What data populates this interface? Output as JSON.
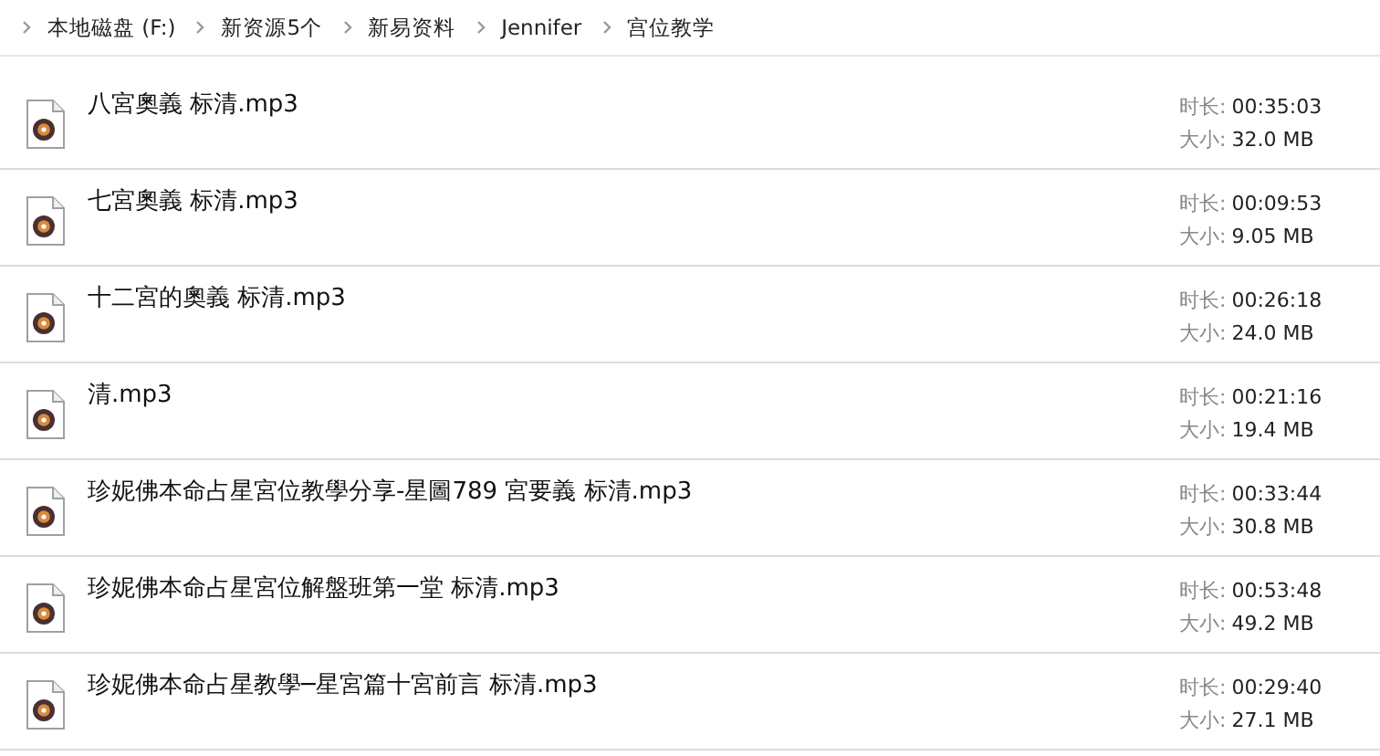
{
  "breadcrumb": [
    "本地磁盘 (F:)",
    "新资源5个",
    "新易资料",
    "Jennifer",
    "宫位教学"
  ],
  "files": [
    {
      "name": "八宮奧義 标清.mp3",
      "duration_label": "时长:",
      "duration": "00:35:03",
      "size_label": "大小:",
      "size": "32.0 MB"
    },
    {
      "name": "七宮奧義 标清.mp3",
      "duration_label": "时长:",
      "duration": "00:09:53",
      "size_label": "大小:",
      "size": "9.05 MB"
    },
    {
      "name": "十二宮的奧義 标清.mp3",
      "duration_label": "时长:",
      "duration": "00:26:18",
      "size_label": "大小:",
      "size": "24.0 MB"
    },
    {
      "name": "清.mp3",
      "duration_label": "时长:",
      "duration": "00:21:16",
      "size_label": "大小:",
      "size": "19.4 MB"
    },
    {
      "name": "珍妮佛本命占星宮位教學分享-星圖789 宮要義 标清.mp3",
      "duration_label": "时长:",
      "duration": "00:33:44",
      "size_label": "大小:",
      "size": "30.8 MB"
    },
    {
      "name": "珍妮佛本命占星宮位解盤班第一堂 标清.mp3",
      "duration_label": "时长:",
      "duration": "00:53:48",
      "size_label": "大小:",
      "size": "49.2 MB"
    },
    {
      "name": "珍妮佛本命占星教學─星宮篇十宮前言 标清.mp3",
      "duration_label": "时长:",
      "duration": "00:29:40",
      "size_label": "大小:",
      "size": "27.1 MB"
    }
  ]
}
